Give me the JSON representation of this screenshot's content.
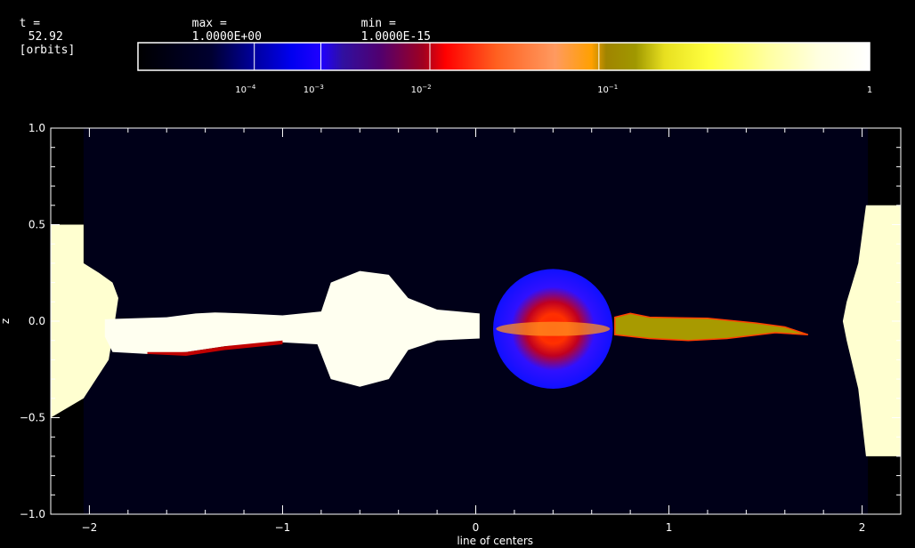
{
  "header": {
    "time_label": "t =",
    "time_value": "52.92",
    "time_unit": "[orbits]",
    "max_label": "max =",
    "max_value": "1.0000E+00",
    "min_label": "min =",
    "min_value": "1.0000E-15"
  },
  "colorbar": {
    "stops": [
      {
        "pos": 0.0,
        "color": "#000000"
      },
      {
        "pos": 0.1,
        "color": "#000030"
      },
      {
        "pos": 0.16,
        "color": "#0000a0"
      },
      {
        "pos": 0.21,
        "color": "#0000f0"
      },
      {
        "pos": 0.25,
        "color": "#2000ff"
      },
      {
        "pos": 0.28,
        "color": "#3010a0"
      },
      {
        "pos": 0.33,
        "color": "#500070"
      },
      {
        "pos": 0.39,
        "color": "#a00020"
      },
      {
        "pos": 0.42,
        "color": "#ff0000"
      },
      {
        "pos": 0.49,
        "color": "#ff6020"
      },
      {
        "pos": 0.57,
        "color": "#ff9a60"
      },
      {
        "pos": 0.62,
        "color": "#ffa000"
      },
      {
        "pos": 0.64,
        "color": "#a08400"
      },
      {
        "pos": 0.68,
        "color": "#a09800"
      },
      {
        "pos": 0.72,
        "color": "#e8e020"
      },
      {
        "pos": 0.78,
        "color": "#ffff40"
      },
      {
        "pos": 0.86,
        "color": "#ffffa0"
      },
      {
        "pos": 0.93,
        "color": "#ffffe0"
      },
      {
        "pos": 1.0,
        "color": "#ffffff"
      }
    ],
    "dividers": [
      0.159,
      0.25,
      0.399,
      0.63
    ],
    "ticks": [
      {
        "base": "10",
        "exp": "−4",
        "pos": 0.147
      },
      {
        "base": "10",
        "exp": "−3",
        "pos": 0.24
      },
      {
        "base": "10",
        "exp": "−2",
        "pos": 0.387
      },
      {
        "base": "10",
        "exp": "−1",
        "pos": 0.642
      },
      {
        "base": "1",
        "exp": "",
        "pos": 1.0
      }
    ]
  },
  "chart_data": {
    "type": "heatmap",
    "xlabel": "line of centers",
    "ylabel": "z",
    "xlim": [
      -2.2,
      2.2
    ],
    "ylim": [
      -1.0,
      1.0
    ],
    "xticks": [
      -2,
      -1,
      0,
      1,
      2
    ],
    "xtick_labels": [
      "−2",
      "−1",
      "0",
      "1",
      "2"
    ],
    "yticks": [
      -1.0,
      -0.5,
      0.0,
      0.5,
      1.0
    ],
    "ytick_labels": [
      "−1.0",
      "−0.5",
      "0.0",
      "0.5",
      "1.0"
    ],
    "background_value_color": "#000018",
    "features": [
      {
        "name": "left-edge-disk",
        "color": "#ffffd0",
        "outline": [
          [
            -2.2,
            -0.5
          ],
          [
            -2.03,
            -0.4
          ],
          [
            -1.9,
            -0.2
          ],
          [
            -1.88,
            -0.08
          ],
          [
            -1.85,
            0.12
          ],
          [
            -1.88,
            0.2
          ],
          [
            -1.95,
            0.25
          ],
          [
            -2.03,
            0.3
          ],
          [
            -2.03,
            0.5
          ],
          [
            -2.2,
            0.5
          ]
        ]
      },
      {
        "name": "left-stream",
        "color": "#fffff0",
        "outline": [
          [
            -1.92,
            0.01
          ],
          [
            -1.6,
            0.02
          ],
          [
            -1.45,
            0.04
          ],
          [
            -1.35,
            0.045
          ],
          [
            -1.2,
            0.04
          ],
          [
            -1.0,
            0.03
          ],
          [
            -0.8,
            0.05
          ],
          [
            -0.75,
            0.2
          ],
          [
            -0.6,
            0.26
          ],
          [
            -0.45,
            0.24
          ],
          [
            -0.35,
            0.12
          ],
          [
            -0.2,
            0.06
          ],
          [
            0.02,
            0.04
          ],
          [
            0.02,
            -0.09
          ],
          [
            -0.2,
            -0.1
          ],
          [
            -0.35,
            -0.15
          ],
          [
            -0.45,
            -0.3
          ],
          [
            -0.6,
            -0.34
          ],
          [
            -0.75,
            -0.3
          ],
          [
            -0.82,
            -0.12
          ],
          [
            -1.0,
            -0.11
          ],
          [
            -1.3,
            -0.13
          ],
          [
            -1.5,
            -0.16
          ],
          [
            -1.7,
            -0.17
          ],
          [
            -1.88,
            -0.16
          ],
          [
            -1.92,
            -0.08
          ]
        ]
      },
      {
        "name": "stream-red-rim",
        "color": "#c00000",
        "outline": [
          [
            -1.7,
            -0.17
          ],
          [
            -1.5,
            -0.18
          ],
          [
            -1.3,
            -0.15
          ],
          [
            -1.0,
            -0.12
          ],
          [
            -1.0,
            -0.1
          ],
          [
            -1.3,
            -0.13
          ],
          [
            -1.5,
            -0.16
          ],
          [
            -1.7,
            -0.16
          ]
        ]
      },
      {
        "name": "accretor-sphere",
        "color": "#1010ff",
        "circle": {
          "cx": 0.4,
          "cy": -0.04,
          "r": 0.31
        }
      },
      {
        "name": "right-stream",
        "color": "#a89a00",
        "outline": [
          [
            0.72,
            0.02
          ],
          [
            0.8,
            0.04
          ],
          [
            0.9,
            0.02
          ],
          [
            1.2,
            0.015
          ],
          [
            1.45,
            -0.01
          ],
          [
            1.6,
            -0.03
          ],
          [
            1.72,
            -0.07
          ],
          [
            1.55,
            -0.06
          ],
          [
            1.3,
            -0.09
          ],
          [
            1.1,
            -0.1
          ],
          [
            0.9,
            -0.09
          ],
          [
            0.72,
            -0.07
          ]
        ]
      },
      {
        "name": "right-edge-disk",
        "color": "#ffffd0",
        "outline": [
          [
            2.2,
            0.6
          ],
          [
            2.02,
            0.6
          ],
          [
            1.98,
            0.3
          ],
          [
            1.92,
            0.1
          ],
          [
            1.9,
            0.0
          ],
          [
            1.92,
            -0.1
          ],
          [
            1.98,
            -0.35
          ],
          [
            2.02,
            -0.7
          ],
          [
            2.2,
            -0.7
          ]
        ]
      }
    ]
  }
}
